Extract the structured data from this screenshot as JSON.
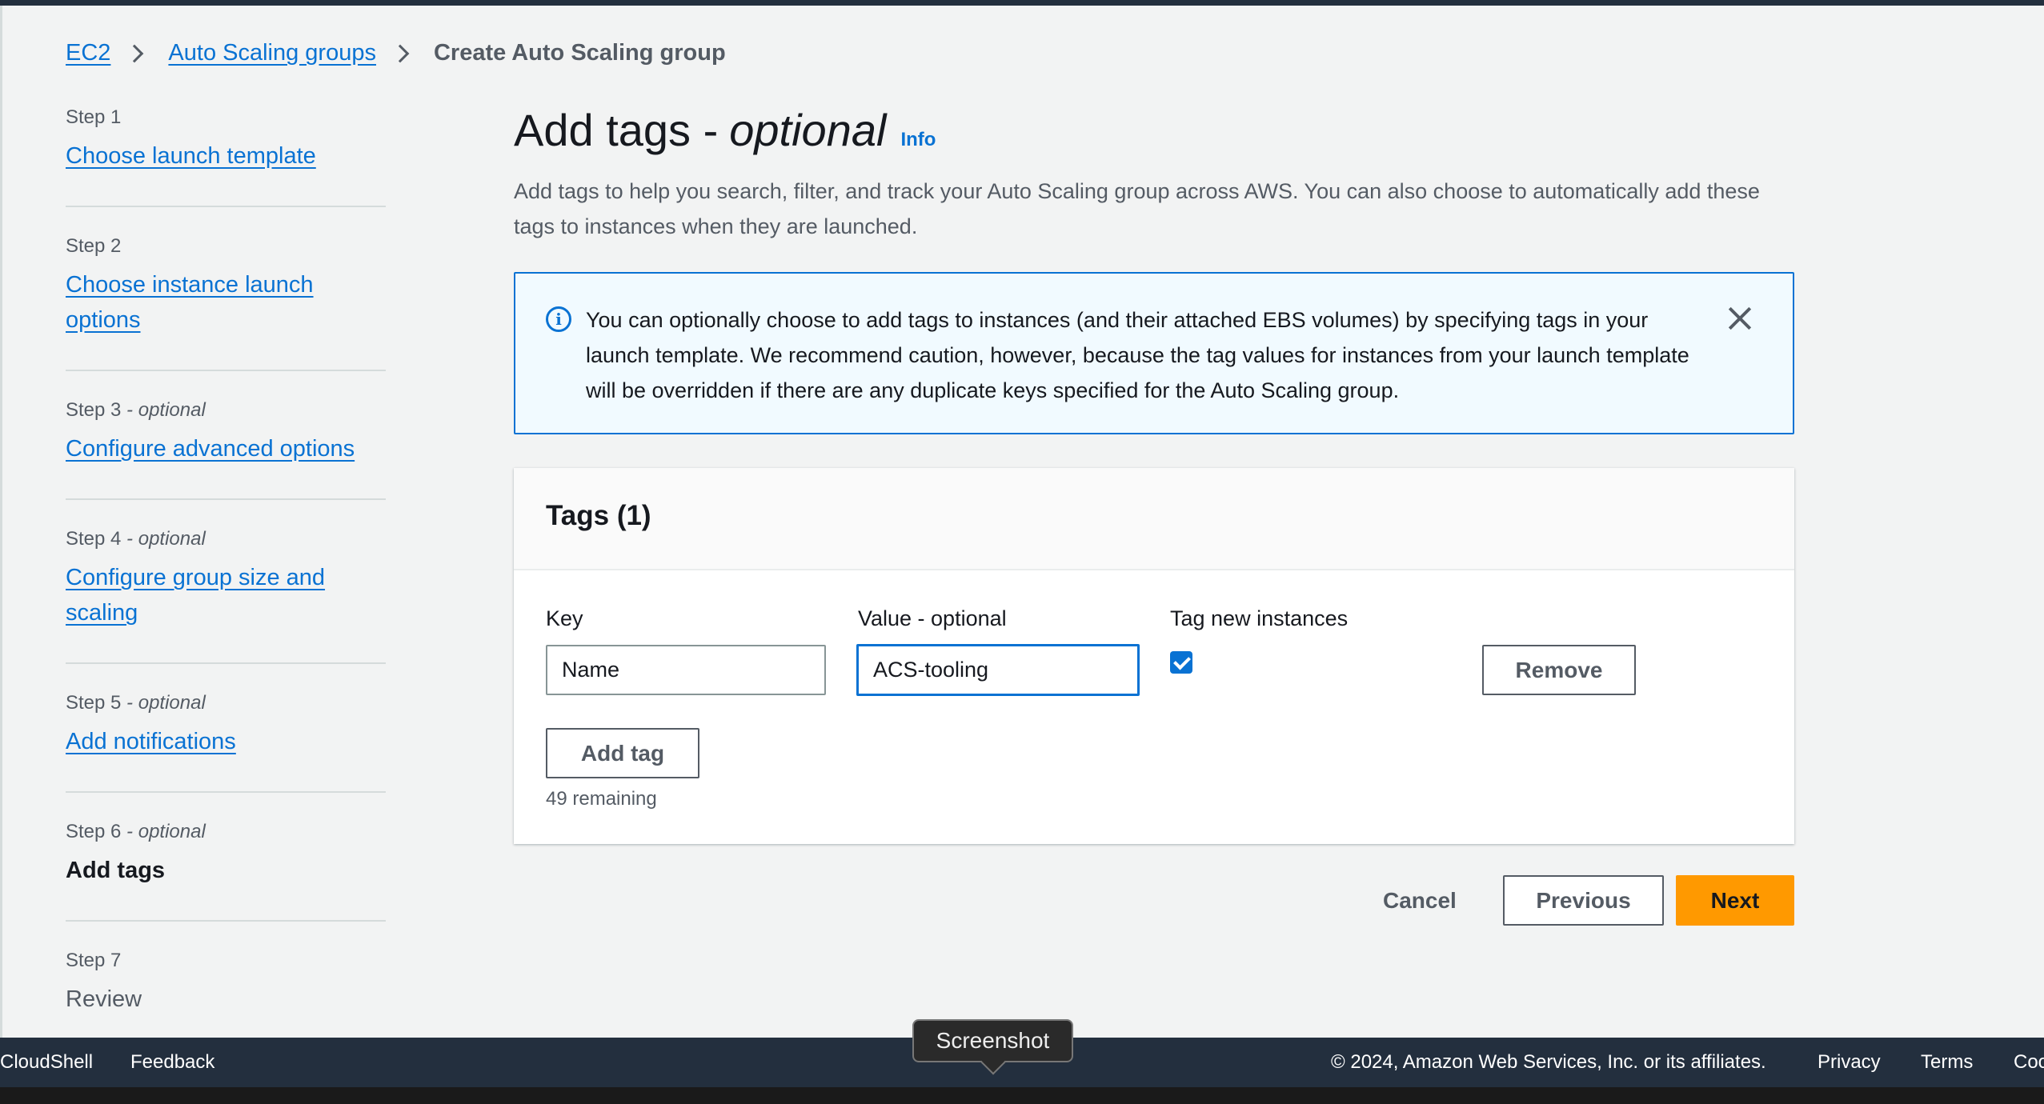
{
  "breadcrumb": {
    "items": [
      "EC2",
      "Auto Scaling groups"
    ],
    "current": "Create Auto Scaling group"
  },
  "steps": [
    {
      "label": "Step 1",
      "optional": "",
      "title": "Choose launch template"
    },
    {
      "label": "Step 2",
      "optional": "",
      "title": "Choose instance launch options"
    },
    {
      "label": "Step 3",
      "optional": " - optional",
      "title": "Configure advanced options"
    },
    {
      "label": "Step 4",
      "optional": " - optional",
      "title": "Configure group size and scaling"
    },
    {
      "label": "Step 5",
      "optional": " - optional",
      "title": "Add notifications"
    },
    {
      "label": "Step 6",
      "optional": " - optional",
      "title": "Add tags"
    },
    {
      "label": "Step 7",
      "optional": "",
      "title": "Review"
    }
  ],
  "header": {
    "title": "Add tags - ",
    "title_optional": "optional",
    "info": "Info",
    "description": "Add tags to help you search, filter, and track your Auto Scaling group across AWS. You can also choose to automatically add these tags to instances when they are launched."
  },
  "alert": {
    "text": "You can optionally choose to add tags to instances (and their attached EBS volumes) by specifying tags in your launch template. We recommend caution, however, because the tag values for instances from your launch template will be overridden if there are any duplicate keys specified for the Auto Scaling group."
  },
  "tags": {
    "title": "Tags (1)",
    "key_label": "Key",
    "value_label": "Value - optional",
    "tag_new_label": "Tag new instances",
    "key_value": "Name",
    "value_value": "ACS-tooling",
    "tag_new_checked": true,
    "remove_label": "Remove",
    "add_tag_label": "Add tag",
    "remaining": "49 remaining"
  },
  "actions": {
    "cancel": "Cancel",
    "previous": "Previous",
    "next": "Next"
  },
  "footer": {
    "cloudshell": "CloudShell",
    "feedback": "Feedback",
    "copyright": "© 2024, Amazon Web Services, Inc. or its affiliates.",
    "privacy": "Privacy",
    "terms": "Terms",
    "cookie": "Coo"
  },
  "tooltip": "Screenshot",
  "colors": {
    "link": "#0972d3",
    "primary": "#ff9900",
    "nav_dark": "#232f3e",
    "alert_bg": "#f1faff"
  }
}
